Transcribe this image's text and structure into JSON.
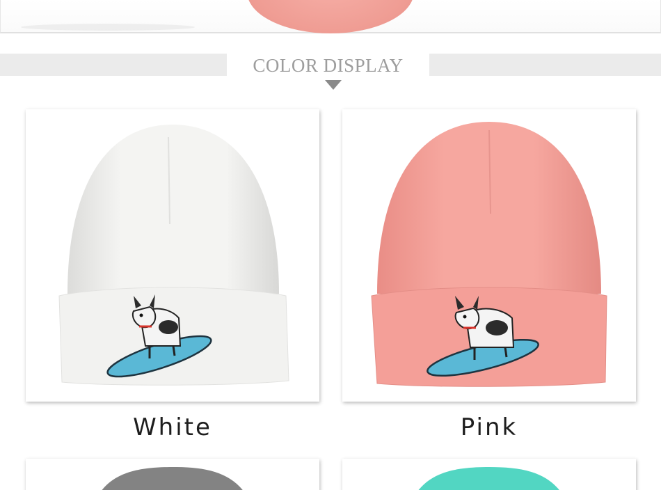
{
  "section": {
    "title": "COLOR DISPLAY"
  },
  "colors": {
    "white_hat": "#f7f7f5",
    "pink_hat": "#f4a29b",
    "gray_hat": "#848484",
    "mint_hat": "#52d6c2",
    "skateboard": "#56b7d4"
  },
  "products": [
    {
      "label": "White"
    },
    {
      "label": "Pink"
    }
  ]
}
